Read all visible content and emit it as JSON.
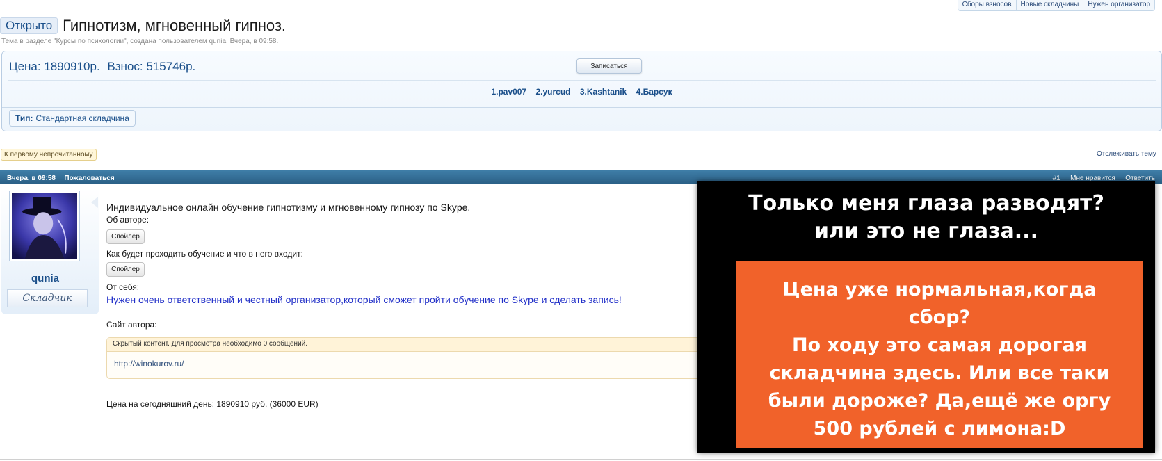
{
  "top_links": [
    "Сборы взносов",
    "Новые складчины",
    "Нужен организатор"
  ],
  "thread": {
    "prefix": "Открыто",
    "title": "Гипнотизм, мгновенный гипноз.",
    "subtitle": "Тема в разделе \"Курсы по психологии\", создана пользователем qunia, Вчера, в 09:58."
  },
  "pricebox": {
    "price": "Цена: 1890910р.",
    "fee": "Взнос: 515746р.",
    "join_label": "Записаться",
    "members": [
      "1.pav007",
      "2.yurcud",
      "3.Kashtanik",
      "4.Барсук"
    ],
    "type_label": "Тип:",
    "type_value": "Стандартная складчина"
  },
  "nav": {
    "first_unread": "К первому непрочитанному",
    "watch_thread": "Отслеживать тему"
  },
  "postbar": {
    "date": "Вчера, в 09:58",
    "report": "Пожаловаться",
    "number": "#1",
    "like": "Мне нравится",
    "reply": "Ответить"
  },
  "user": {
    "name": "qunia",
    "rank": "Складчик"
  },
  "message": {
    "intro": "Индивидуальное онлайн обучение гипнотизму и мгновенному гипнозу по Skype.",
    "about_author": "Об авторе:",
    "spoiler_label": "Спойлер",
    "how_label": "Как будет проходить обучение и что в него входит:",
    "from_me": "От себя:",
    "blue_text": "Нужен очень ответственный и честный организатор,который сможет пройти обучение по Skype и сделать запись!",
    "site_label": "Сайт автора:",
    "hidden_notice": "Скрытый контент. Для просмотра необходимо 0 сообщений.",
    "hidden_link": "http://winokurov.ru/",
    "price_today": "Цена на сегодняшний день: 1890910 руб. (36000 EUR)"
  },
  "overlay": {
    "black_line1": "Только меня глаза разводят?",
    "black_line2": "или это не глаза...",
    "orange_lines": [
      "Цена уже нормальная,когда",
      "сбор?",
      "По ходу это самая дорогая",
      "складчина здесь. Или все таки",
      "были дороже? Да,ещё же оргу",
      "500 рублей с лимона:D"
    ],
    "black_color": "#000000",
    "orange_color": "#f1622a"
  },
  "colors": {
    "accent": "#1a4f8a",
    "postbar": "#2a5f85",
    "link_blue": "#2230c8"
  }
}
